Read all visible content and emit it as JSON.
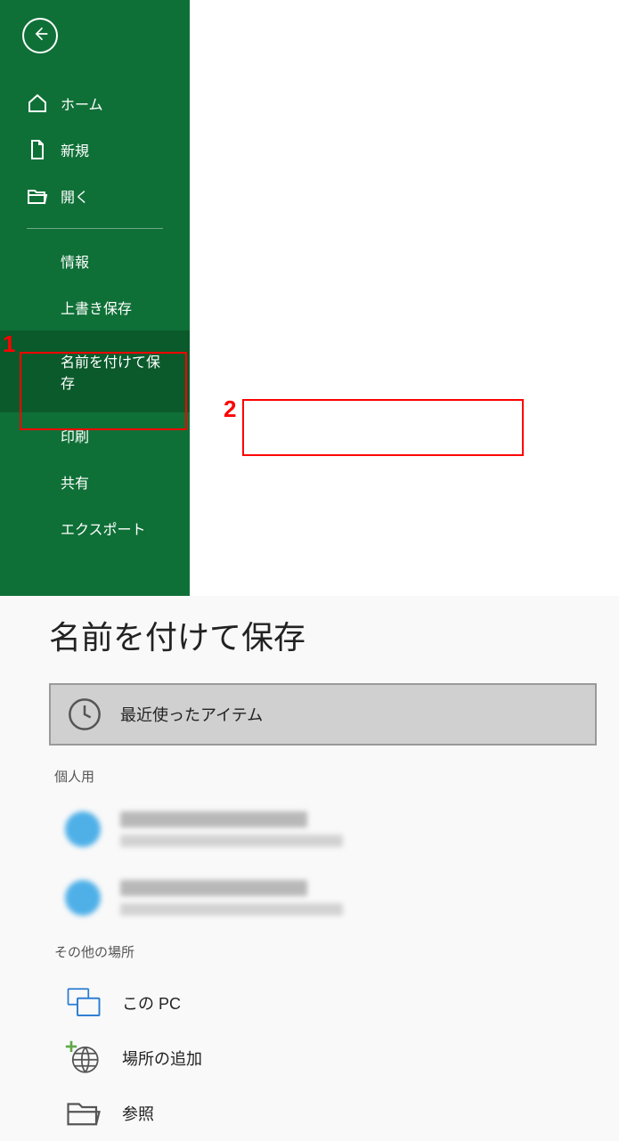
{
  "sidebar": {
    "home": "ホーム",
    "new": "新規",
    "open": "開く",
    "info": "情報",
    "save": "上書き保存",
    "save_as": "名前を付けて保存",
    "print": "印刷",
    "share": "共有",
    "export": "エクスポート"
  },
  "main": {
    "title": "名前を付けて保存",
    "recent": "最近使ったアイテム",
    "personal": "個人用",
    "other_locations": "その他の場所",
    "this_pc": "この PC",
    "add_place": "場所の追加",
    "browse": "参照"
  },
  "callouts": {
    "one": "1",
    "two": "2"
  },
  "colors": {
    "sidebar_bg": "#0f7037",
    "selected_bg": "#0a5a2b",
    "highlight": "#ff0000"
  }
}
